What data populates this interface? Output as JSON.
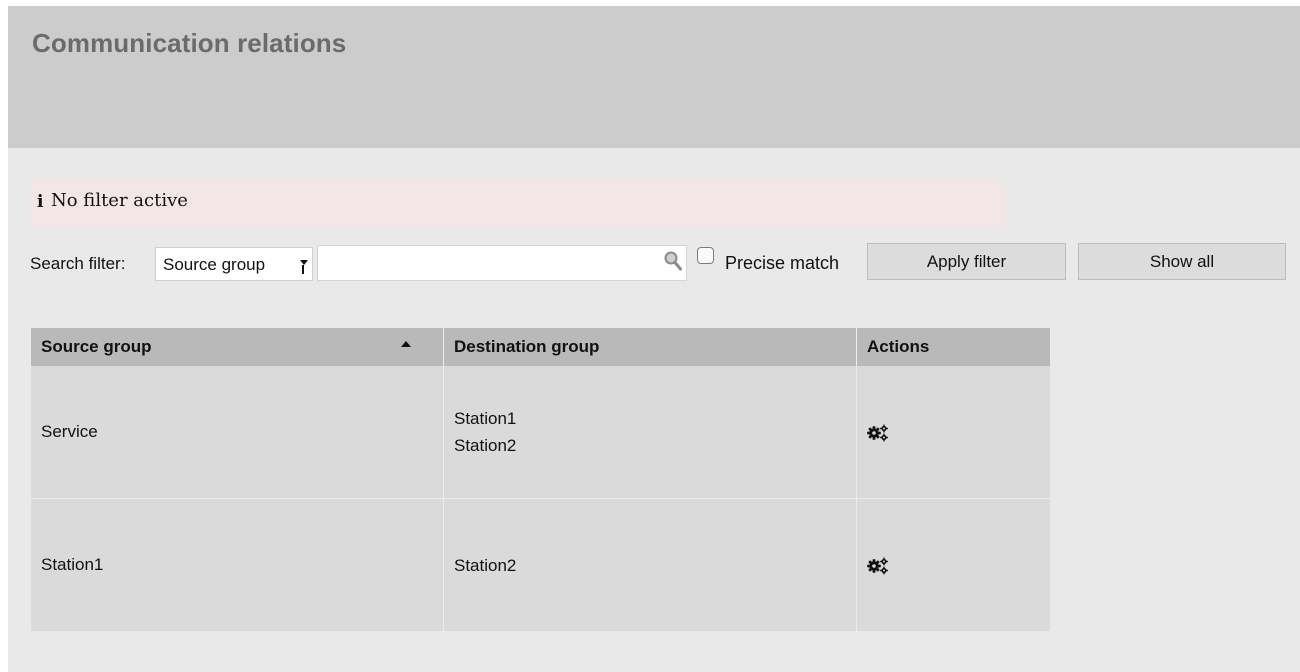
{
  "page": {
    "title": "Communication relations"
  },
  "notice": {
    "icon": "info-icon",
    "text": "No filter active"
  },
  "filter": {
    "label": "Search filter:",
    "selected_field": "Source group",
    "search_value": "",
    "search_placeholder": "",
    "precise_match_label": "Precise match",
    "precise_match_checked": false,
    "apply_label": "Apply filter",
    "show_all_label": "Show all"
  },
  "table": {
    "columns": [
      "Source group",
      "Destination group",
      "Actions"
    ],
    "sort_column": "Source group",
    "sort_direction": "ascending",
    "rows": [
      {
        "source": "Service",
        "destinations": [
          "Station1",
          "Station2"
        ],
        "action_icon": "gear-icon"
      },
      {
        "source": "Station1",
        "destinations": [
          "Station2"
        ],
        "action_icon": "gear-icon"
      }
    ]
  },
  "colors": {
    "header_bg": "#cccccc",
    "page_bg": "#e9e9e9",
    "notice_bg": "#f2e6e6",
    "table_header_bg": "#b9b9b9",
    "table_row_bg": "#dadada",
    "title_text": "#6b6b6b"
  }
}
